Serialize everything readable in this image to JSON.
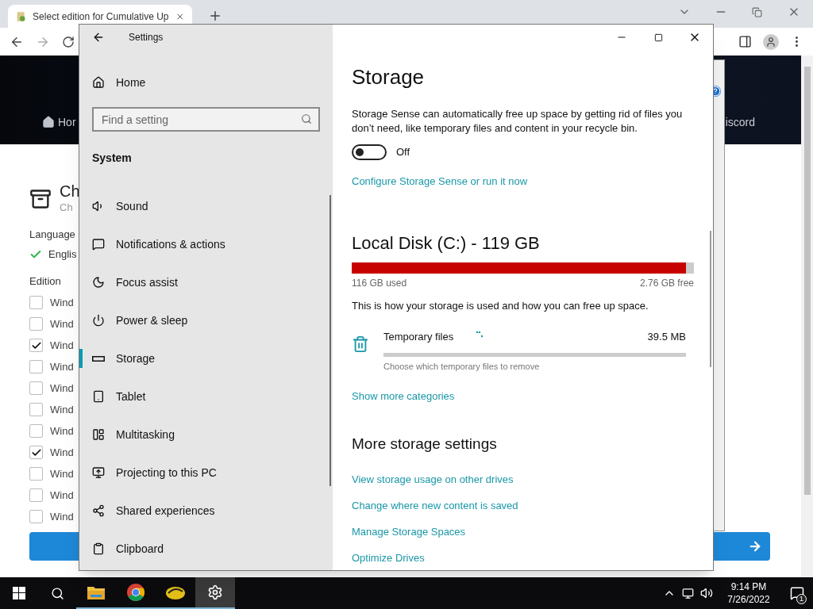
{
  "browser": {
    "tab": {
      "title": "Select edition for Cumulative Up"
    }
  },
  "web_page": {
    "nav": [
      "Hor",
      "iscord"
    ],
    "title": "Ch",
    "subtitle": "Ch",
    "language_label": "Language",
    "language_value": "Englis",
    "edition_label": "Edition",
    "editions": [
      {
        "label": "Wind",
        "checked": false
      },
      {
        "label": "Wind",
        "checked": false
      },
      {
        "label": "Wind",
        "checked": true
      },
      {
        "label": "Wind",
        "checked": false
      },
      {
        "label": "Wind",
        "checked": false
      },
      {
        "label": "Wind",
        "checked": false
      },
      {
        "label": "Wind",
        "checked": false
      },
      {
        "label": "Wind",
        "checked": true
      },
      {
        "label": "Wind",
        "checked": false
      },
      {
        "label": "Wind",
        "checked": false
      },
      {
        "label": "Wind",
        "checked": false
      }
    ]
  },
  "settings": {
    "title": "Settings",
    "home": "Home",
    "search": {
      "placeholder": "Find a setting"
    },
    "section": "System",
    "nav": [
      {
        "kind": "sound",
        "label": "Sound",
        "selected": false
      },
      {
        "kind": "notifications",
        "label": "Notifications & actions",
        "selected": false
      },
      {
        "kind": "focus",
        "label": "Focus assist",
        "selected": false
      },
      {
        "kind": "power",
        "label": "Power & sleep",
        "selected": false
      },
      {
        "kind": "storage",
        "label": "Storage",
        "selected": true
      },
      {
        "kind": "tablet",
        "label": "Tablet",
        "selected": false
      },
      {
        "kind": "multitasking",
        "label": "Multitasking",
        "selected": false
      },
      {
        "kind": "projecting",
        "label": "Projecting to this PC",
        "selected": false
      },
      {
        "kind": "shared",
        "label": "Shared experiences",
        "selected": false
      },
      {
        "kind": "clipboard",
        "label": "Clipboard",
        "selected": false
      }
    ],
    "page": {
      "heading": "Storage",
      "description": "Storage Sense can automatically free up space by getting rid of files you don’t need, like temporary files and content in your recycle bin.",
      "toggle": {
        "on": false,
        "label": "Off"
      },
      "configure_link": "Configure Storage Sense or run it now",
      "disk": {
        "title": "Local Disk (C:) - 119 GB",
        "level": 0.977,
        "used": "116 GB used",
        "free": "2.76 GB free"
      },
      "usage_note": "This is how your storage is used and how you can free up space.",
      "categories": [
        {
          "name": "Temporary files",
          "size": "39.5 MB",
          "level": 0,
          "hint": "Choose which temporary files to remove",
          "loading": true
        }
      ],
      "more_link": "Show more categories",
      "more_heading": "More storage settings",
      "links": [
        "View storage usage on other drives",
        "Change where new content is saved",
        "Manage Storage Spaces",
        "Optimize Drives"
      ]
    }
  },
  "taskbar": {
    "apps": [
      {
        "kind": "explorer",
        "selected": false
      },
      {
        "kind": "chrome",
        "selected": false
      },
      {
        "kind": "app",
        "selected": false
      },
      {
        "kind": "settings",
        "selected": true
      }
    ],
    "time": "9:14 PM",
    "date": "7/26/2022",
    "notifications": "1"
  }
}
